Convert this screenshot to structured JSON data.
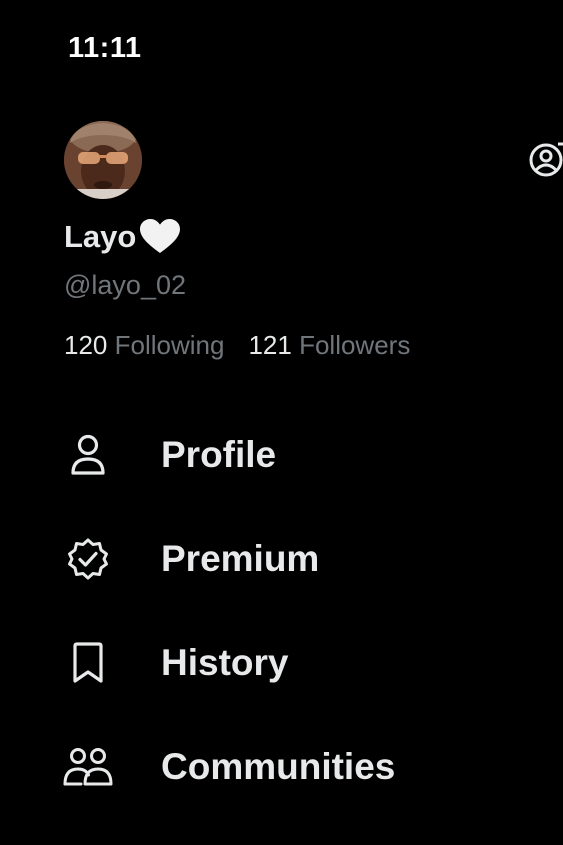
{
  "status_bar": {
    "time": "11:11"
  },
  "profile": {
    "display_name": "Layo",
    "name_emoji_icon": "white-heart-icon",
    "handle": "@layo_02",
    "following_count": "120",
    "following_label": "Following",
    "followers_count": "121",
    "followers_label": "Followers"
  },
  "menu": {
    "items": [
      {
        "label": "Profile",
        "icon": "person-icon"
      },
      {
        "label": "Premium",
        "icon": "verified-badge-icon"
      },
      {
        "label": "History",
        "icon": "bookmark-icon"
      },
      {
        "label": "Communities",
        "icon": "people-icon"
      }
    ]
  },
  "colors": {
    "background": "#000000",
    "primary_text": "#e7e9ea",
    "secondary_text": "#71767b"
  }
}
